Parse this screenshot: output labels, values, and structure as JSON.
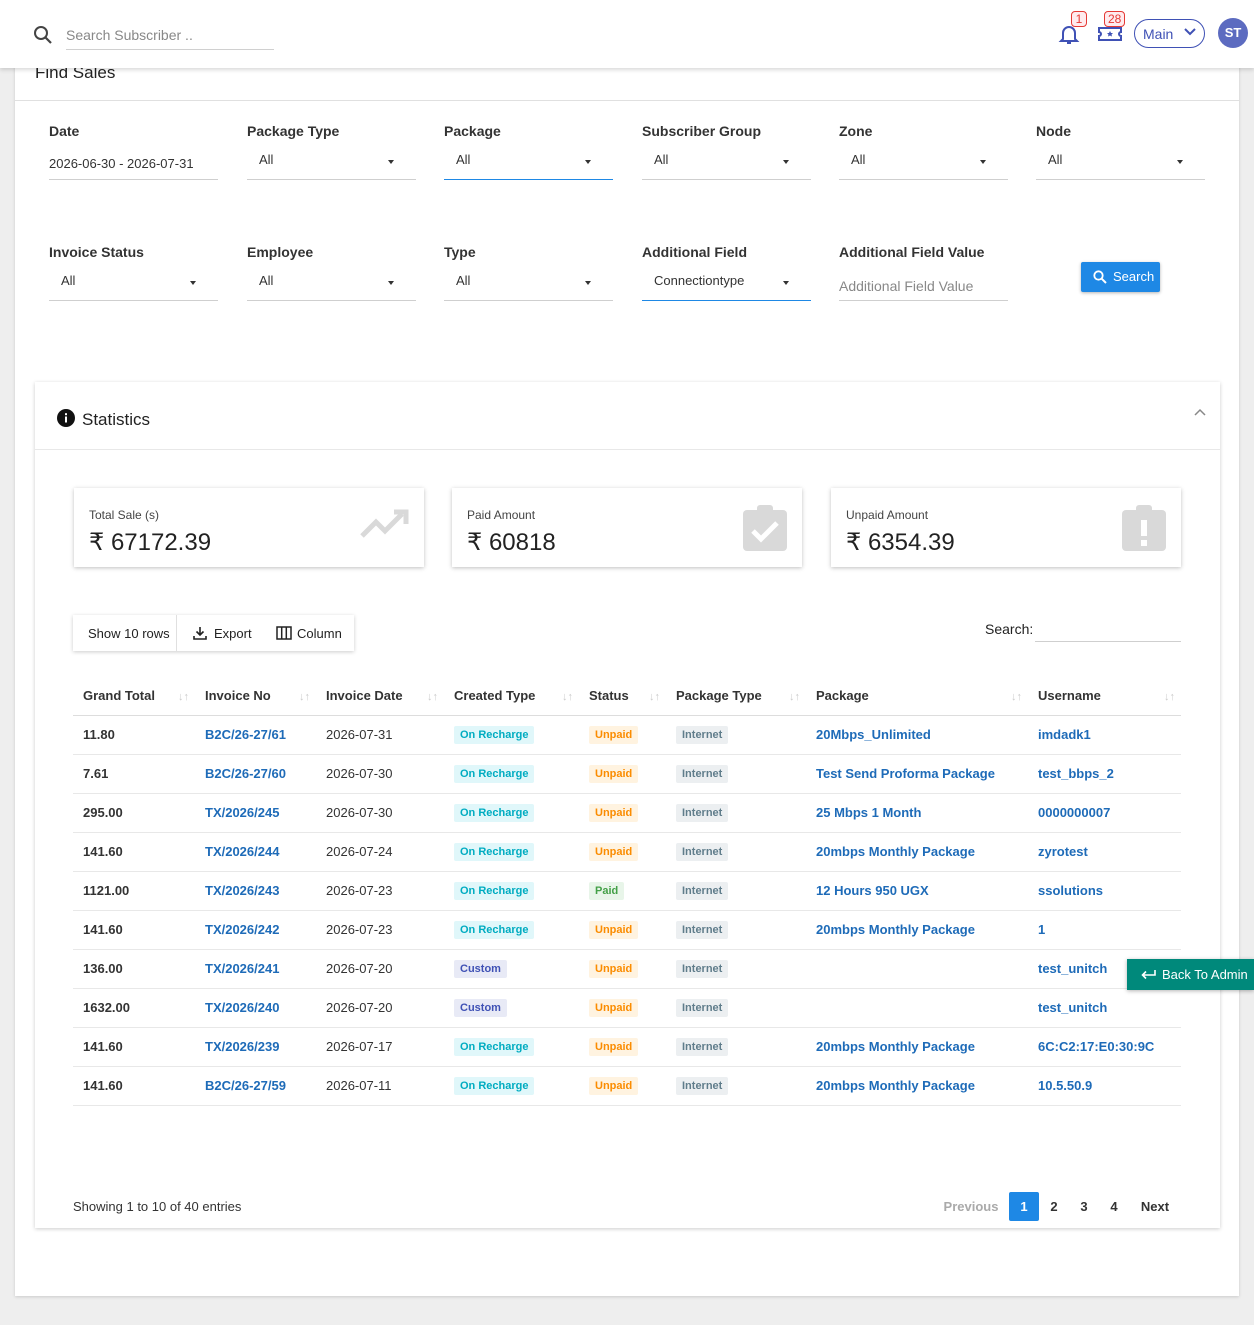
{
  "topbar": {
    "search_placeholder": "Search Subscriber ..",
    "notifications_count": "1",
    "tickets_count": "28",
    "branch_selector": "Main",
    "user_initials": "ST"
  },
  "page": {
    "title": "Find Sales"
  },
  "filters": {
    "row1": [
      {
        "label": "Date",
        "value": "2026-06-30 - 2026-07-31"
      },
      {
        "label": "Package Type",
        "value": "All"
      },
      {
        "label": "Package",
        "value": "All"
      },
      {
        "label": "Subscriber Group",
        "value": "All"
      },
      {
        "label": "Zone",
        "value": "All"
      },
      {
        "label": "Node",
        "value": "All"
      }
    ],
    "row2": [
      {
        "label": "Invoice Status",
        "value": "All"
      },
      {
        "label": "Employee",
        "value": "All"
      },
      {
        "label": "Type",
        "value": "All"
      },
      {
        "label": "Additional Field",
        "value": "Connectiontype"
      },
      {
        "label": "Additional Field Value",
        "placeholder": "Additional Field Value"
      }
    ],
    "search_button": "Search"
  },
  "statistics": {
    "title": "Statistics",
    "kpis": [
      {
        "label": "Total Sale (s)",
        "value": "₹ 67172.39",
        "icon": "trending-up-icon"
      },
      {
        "label": "Paid Amount",
        "value": "₹ 60818",
        "icon": "clipboard-check-icon"
      },
      {
        "label": "Unpaid Amount",
        "value": "₹ 6354.39",
        "icon": "clipboard-alert-icon"
      }
    ],
    "toolbar": {
      "rows": "Show 10 rows",
      "export": "Export",
      "column": "Column"
    },
    "search_label": "Search:"
  },
  "table": {
    "headers": [
      "Grand Total",
      "Invoice No",
      "Invoice Date",
      "Created Type",
      "Status",
      "Package Type",
      "Package",
      "Username"
    ],
    "rows": [
      {
        "total": "11.80",
        "invoice": "B2C/26-27/61",
        "date": "2026-07-31",
        "created": "On Recharge",
        "status": "Unpaid",
        "ptype": "Internet",
        "package": "20Mbps_Unlimited",
        "username": "imdadk1"
      },
      {
        "total": "7.61",
        "invoice": "B2C/26-27/60",
        "date": "2026-07-30",
        "created": "On Recharge",
        "status": "Unpaid",
        "ptype": "Internet",
        "package": "Test Send Proforma Package",
        "username": "test_bbps_2"
      },
      {
        "total": "295.00",
        "invoice": "TX/2026/245",
        "date": "2026-07-30",
        "created": "On Recharge",
        "status": "Unpaid",
        "ptype": "Internet",
        "package": "25 Mbps 1 Month",
        "username": "0000000007"
      },
      {
        "total": "141.60",
        "invoice": "TX/2026/244",
        "date": "2026-07-24",
        "created": "On Recharge",
        "status": "Unpaid",
        "ptype": "Internet",
        "package": "20mbps Monthly Package",
        "username": "zyrotest"
      },
      {
        "total": "1121.00",
        "invoice": "TX/2026/243",
        "date": "2026-07-23",
        "created": "On Recharge",
        "status": "Paid",
        "ptype": "Internet",
        "package": "12 Hours 950 UGX",
        "username": "ssolutions"
      },
      {
        "total": "141.60",
        "invoice": "TX/2026/242",
        "date": "2026-07-23",
        "created": "On Recharge",
        "status": "Unpaid",
        "ptype": "Internet",
        "package": "20mbps Monthly Package",
        "username": "1"
      },
      {
        "total": "136.00",
        "invoice": "TX/2026/241",
        "date": "2026-07-20",
        "created": "Custom",
        "status": "Unpaid",
        "ptype": "Internet",
        "package": "",
        "username": "test_unitch"
      },
      {
        "total": "1632.00",
        "invoice": "TX/2026/240",
        "date": "2026-07-20",
        "created": "Custom",
        "status": "Unpaid",
        "ptype": "Internet",
        "package": "",
        "username": "test_unitch"
      },
      {
        "total": "141.60",
        "invoice": "TX/2026/239",
        "date": "2026-07-17",
        "created": "On Recharge",
        "status": "Unpaid",
        "ptype": "Internet",
        "package": "20mbps Monthly Package",
        "username": "6C:C2:17:E0:30:9C"
      },
      {
        "total": "141.60",
        "invoice": "B2C/26-27/59",
        "date": "2026-07-11",
        "created": "On Recharge",
        "status": "Unpaid",
        "ptype": "Internet",
        "package": "20mbps Monthly Package",
        "username": "10.5.50.9"
      }
    ]
  },
  "pagination": {
    "info": "Showing 1 to 10 of 40 entries",
    "previous": "Previous",
    "pages": [
      "1",
      "2",
      "3",
      "4"
    ],
    "next": "Next",
    "current": "1"
  },
  "floating": {
    "back_to_admin": "Back To Admin"
  },
  "colors": {
    "primary": "#1e88e5",
    "accent": "#3f51b5",
    "teal": "#00897b",
    "link": "#1e6bb8"
  }
}
